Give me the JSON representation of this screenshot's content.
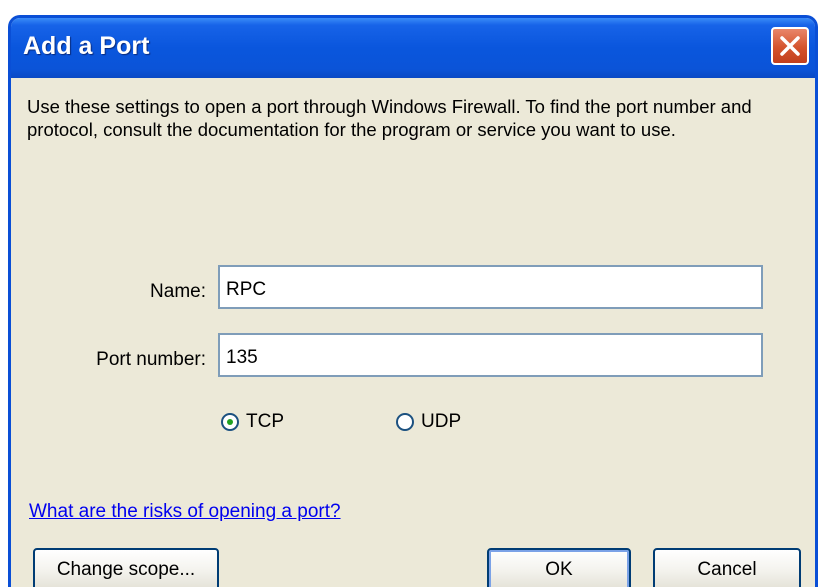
{
  "window": {
    "title": "Add a Port",
    "close_icon": "close-icon"
  },
  "instructions": "Use these settings to open a port through Windows Firewall. To find the port number and protocol, consult the documentation for the program or service you want to use.",
  "form": {
    "name_label": "Name:",
    "name_value": "RPC",
    "port_label": "Port number:",
    "port_value": "135",
    "protocol_options": [
      {
        "label": "TCP",
        "selected": true
      },
      {
        "label": "UDP",
        "selected": false
      }
    ]
  },
  "risk_link": "What are the risks of opening a port?",
  "buttons": {
    "change_scope": "Change scope...",
    "ok": "OK",
    "cancel": "Cancel"
  },
  "colors": {
    "titlebar": "#0a56dd",
    "dialog_bg": "#ece9d8",
    "link": "#0000ee",
    "radio_dot": "#21a121"
  }
}
